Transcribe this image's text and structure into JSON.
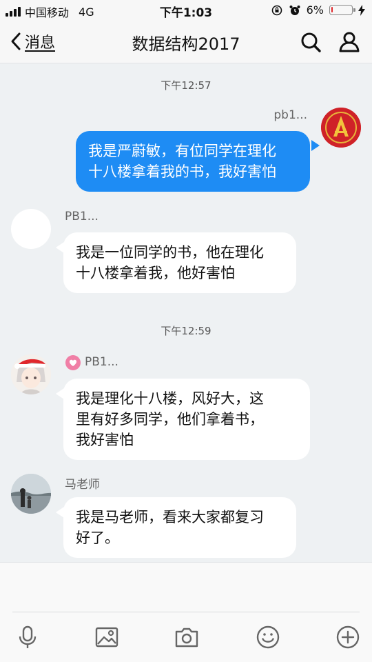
{
  "status_bar": {
    "carrier": "中国移动",
    "network": "4G",
    "time": "下午1:03",
    "battery_percent": "6%",
    "battery_level": 0.06
  },
  "header": {
    "back_label": "消息",
    "title": "数据结构2017"
  },
  "messages": [
    {
      "type": "time",
      "text": "下午12:57"
    },
    {
      "type": "outgoing",
      "sender": "pb1...",
      "lines": [
        "我是严蔚敏，有位同学在理化",
        "十八楼拿着我的书，我好害怕"
      ]
    },
    {
      "type": "incoming",
      "sender": "PB1...",
      "lines": [
        "我是一位同学的书，他在理化",
        "十八楼拿着我，他好害怕"
      ]
    },
    {
      "type": "time",
      "text": "下午12:59"
    },
    {
      "type": "incoming",
      "sender": "PB1...",
      "lines": [
        "我是理化十八楼，风好大，这",
        "里有好多同学，他们拿着书，",
        "我好害怕"
      ]
    },
    {
      "type": "incoming",
      "sender": "马老师",
      "lines": [
        "我是马老师，看来大家都复习",
        "好了。"
      ]
    }
  ],
  "icons": {
    "back": "chevron-left-icon",
    "search": "search-icon",
    "group": "person-icon",
    "toolbar": [
      "microphone-icon",
      "image-icon",
      "camera-icon",
      "emoji-icon",
      "plus-icon"
    ]
  },
  "colors": {
    "outgoing_bubble": "#1e8cf4",
    "incoming_bubble": "#ffffff",
    "chat_background": "#eef1f3"
  }
}
